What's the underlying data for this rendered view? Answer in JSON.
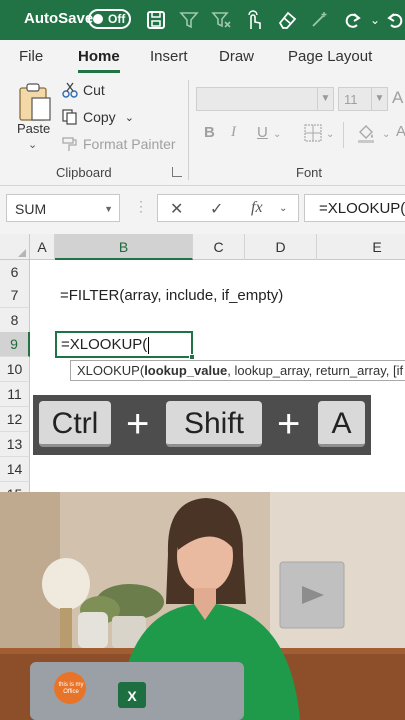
{
  "titlebar": {
    "autosave_label": "AutoSave",
    "toggle_text": "Off",
    "icons": [
      "save-icon",
      "filter-icon",
      "filter-clear-icon",
      "touch-icon",
      "eraser-icon",
      "sparkle-icon",
      "redo-icon",
      "dropdown-icon",
      "undo-icon"
    ]
  },
  "tabs": [
    "File",
    "Home",
    "Insert",
    "Draw",
    "Page Layout"
  ],
  "ribbon": {
    "paste_label": "Paste",
    "cut_label": "Cut",
    "copy_label": "Copy",
    "format_painter_label": "Format Painter",
    "clipboard_group": "Clipboard",
    "font_size": "11",
    "font_group": "Font",
    "bold": "B",
    "italic": "I",
    "underline": "U"
  },
  "formula_bar": {
    "name_box": "SUM",
    "fx_label": "fx",
    "formula": "=XLOOKUP("
  },
  "grid": {
    "columns": [
      "A",
      "B",
      "C",
      "D",
      "E"
    ],
    "rows": [
      "6",
      "7",
      "8",
      "9",
      "10",
      "11",
      "12",
      "13",
      "14",
      "15"
    ],
    "cell_b7": "=FILTER(array, include, if_empty)",
    "active_cell_text": "=XLOOKUP(",
    "tooltip_fn": "XLOOKUP(",
    "tooltip_arg_bold": "lookup_value",
    "tooltip_rest": ", lookup_array, return_array, [if"
  },
  "shortcut": {
    "key1": "Ctrl",
    "plus1": "+",
    "key2": "Shift",
    "plus2": "+",
    "key3": "A"
  },
  "video": {
    "laptop_sticker": "this is my Office",
    "accent_color": "#1f9a4a"
  },
  "colors": {
    "excel_green": "#217346"
  }
}
